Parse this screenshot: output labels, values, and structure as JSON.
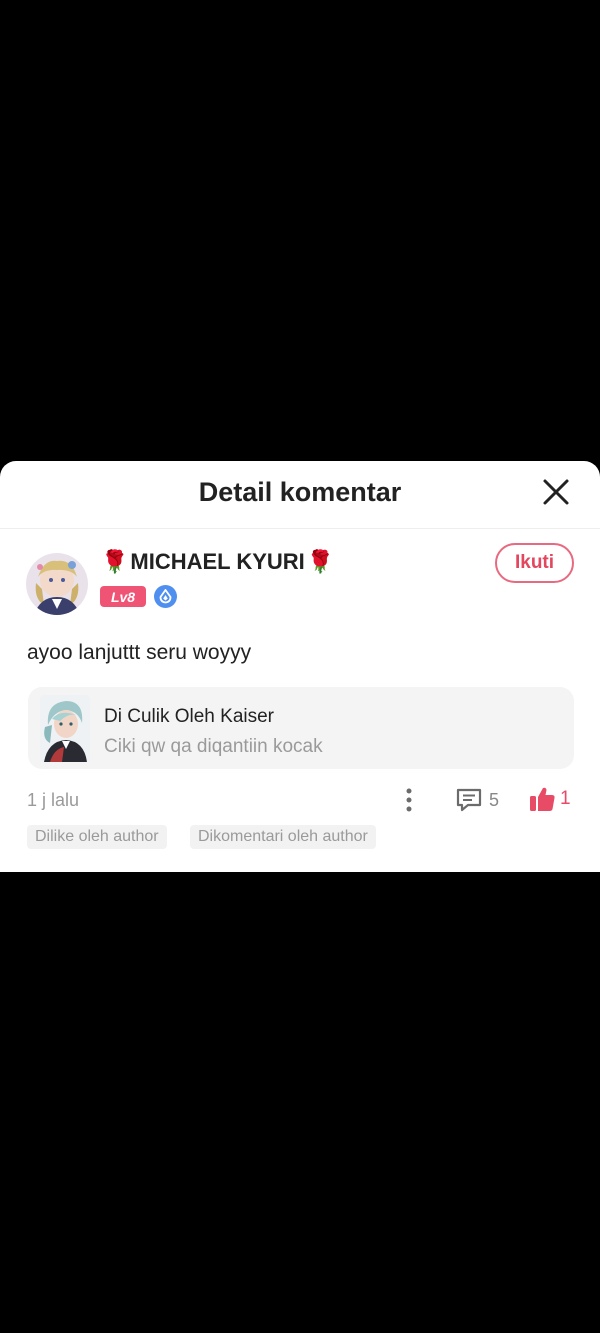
{
  "sheet": {
    "title": "Detail komentar"
  },
  "comment": {
    "username": "MICHAEL KYURI",
    "name_decoration": "🌹",
    "level": "Lv8",
    "follow_label": "Ikuti",
    "text": "ayoo lanjuttt seru woyyy",
    "time": "1 j lalu",
    "reply_count": "5",
    "like_count": "1"
  },
  "chapter": {
    "title": "Di Culik Oleh Kaiser",
    "subtitle": "Ciki qw qa diqantiin kocak"
  },
  "tags": {
    "liked": "Dilike oleh author",
    "commented": "Dikomentari oleh author"
  },
  "colors": {
    "accent": "#e2475f",
    "level_badge": "#ef5474",
    "gem_badge": "#4f8ff0",
    "muted_text": "#9a9a9a"
  }
}
